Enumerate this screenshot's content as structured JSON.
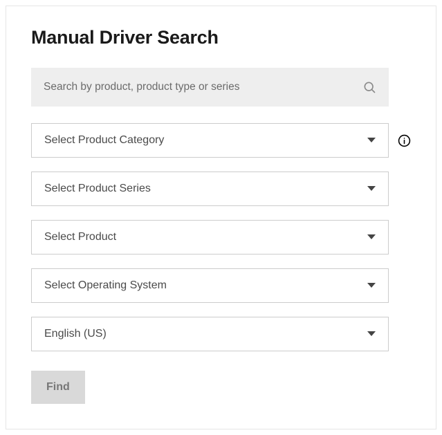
{
  "title": "Manual Driver Search",
  "search": {
    "placeholder": "Search by product, product type or series"
  },
  "dropdowns": {
    "category": "Select Product Category",
    "series": "Select Product Series",
    "product": "Select Product",
    "os": "Select Operating System",
    "language": "English (US)"
  },
  "buttons": {
    "find": "Find"
  }
}
